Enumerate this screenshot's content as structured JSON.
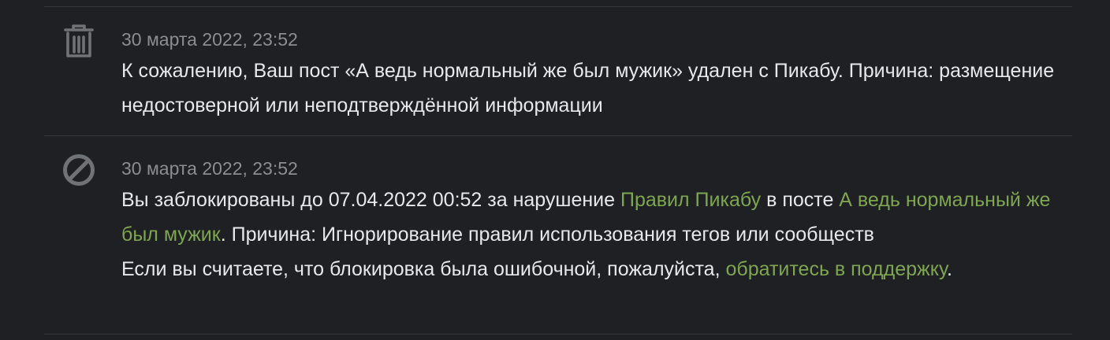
{
  "notifications": [
    {
      "icon": "trash-icon",
      "timestamp": "30 марта 2022, 23:52",
      "message": "К сожалению, Ваш пост «А ведь нормальный же был мужик» удален с Пикабу. Причина: размещение недостоверной или неподтверждённой информации"
    },
    {
      "icon": "ban-icon",
      "timestamp": "30 марта 2022, 23:52",
      "text_1": "Вы заблокированы до 07.04.2022 00:52 за нарушение ",
      "rules_link": "Правил Пикабу",
      "text_2": " в посте ",
      "post_link": "А ведь нормальный же был мужик",
      "text_3": ". Причина: Игнорирование правил использования тегов или сообществ",
      "text_4": "Если вы считаете, что блокировка была ошибочной, пожалуйста, ",
      "support_link": "обратитесь в поддержку",
      "text_5": "."
    }
  ],
  "colors": {
    "background": "#1f2023",
    "text": "#e7e8ea",
    "muted": "#8a8d91",
    "link": "#7ea651",
    "divider": "#36383c",
    "icon": "#6f7276"
  }
}
